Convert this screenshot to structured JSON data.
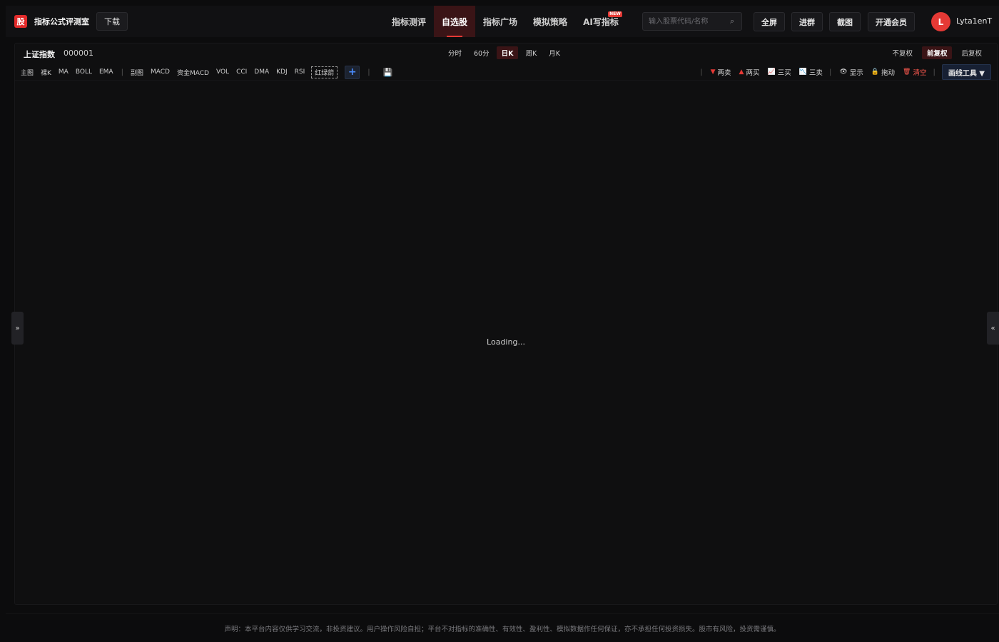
{
  "brand": {
    "logo_char": "股",
    "name": "指标公式评测室"
  },
  "header": {
    "download_label": "下载",
    "nav": [
      {
        "label": "指标测评"
      },
      {
        "label": "自选股",
        "active": true
      },
      {
        "label": "指标广场"
      },
      {
        "label": "模拟策略"
      },
      {
        "label": "AI写指标",
        "badge": "NEW"
      }
    ],
    "search_placeholder": "输入股票代码/名称",
    "search_icon": "search-icon",
    "buttons": {
      "fullscreen": "全屏",
      "join_group": "进群",
      "screenshot": "截图",
      "vip": "开通会员"
    },
    "user": {
      "avatar_letter": "L",
      "name": "Lyta1enT"
    }
  },
  "chart_panel": {
    "stock_name": "上证指数",
    "stock_code": "000001",
    "periods": [
      "分时",
      "60分",
      "日K",
      "周K",
      "月K"
    ],
    "active_period": "日K",
    "adjust": [
      "不复权",
      "前复权",
      "后复权"
    ],
    "active_adjust": "前复权",
    "main_indicators": [
      "主图",
      "裸K",
      "MA",
      "BOLL",
      "EMA"
    ],
    "sub_indicators": [
      "副图",
      "MACD",
      "资金MACD",
      "VOL",
      "CCI",
      "DMA",
      "KDJ",
      "RSI"
    ],
    "custom_indicator": "红绿箭",
    "add_label": "+",
    "tools": {
      "two_sell": "两卖",
      "two_buy": "两买",
      "three_buy": "三买",
      "three_sell": "三卖",
      "show": "显示",
      "drag": "拖动",
      "clear": "清空",
      "drawing_tools": "画线工具 ▼"
    },
    "loading_text": "Loading..."
  },
  "side_toggles": {
    "left": "»",
    "right": "«"
  },
  "footer": {
    "disclaimer": "声明：本平台内容仅供学习交流，非投资建议。用户操作风险自担；平台不对指标的准确性、有效性、盈利性、模拟数据作任何保证，亦不承担任何投资损失。股市有风险，投资需谨慎。"
  },
  "colors": {
    "accent": "#e53935",
    "bg": "#0c0c0d",
    "active_tab_bg": "#3a1416"
  }
}
